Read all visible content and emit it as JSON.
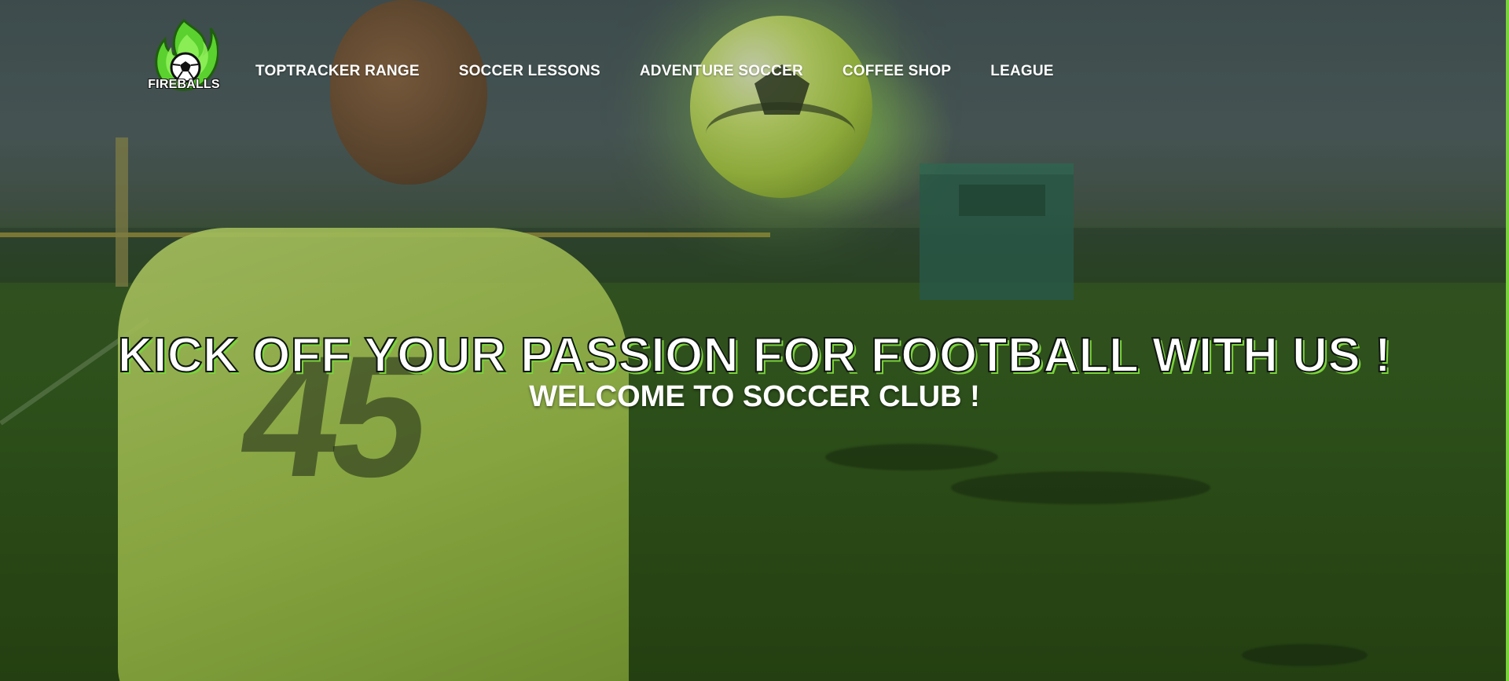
{
  "brand": {
    "logo_text": "FIREBALLS",
    "logo_icon": "soccer-ball-flame-icon",
    "colors": {
      "accent": "#7bd33c",
      "text": "#ffffff"
    }
  },
  "nav": {
    "items": [
      {
        "label": "TOPTRACKER RANGE"
      },
      {
        "label": "SOCCER LESSONS"
      },
      {
        "label": "ADVENTURE SOCCER"
      },
      {
        "label": "COFFEE SHOP"
      },
      {
        "label": "LEAGUE"
      }
    ]
  },
  "hero": {
    "title": "KICK OFF YOUR PASSION FOR FOOTBALL WITH US !",
    "subtitle": "WELCOME TO SOCCER CLUB !"
  }
}
